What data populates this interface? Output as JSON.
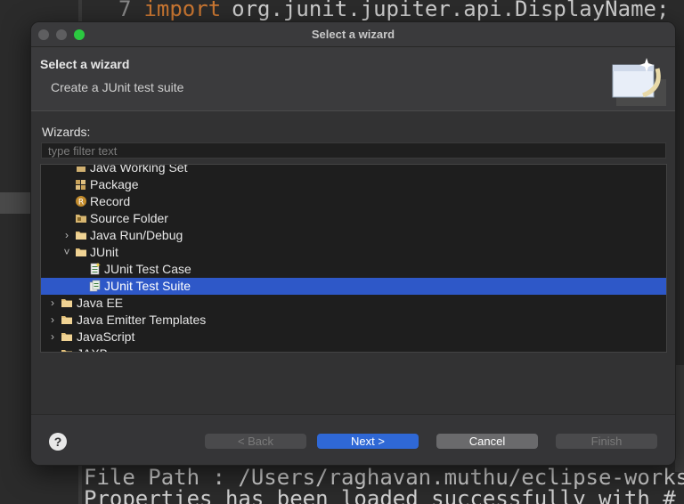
{
  "background": {
    "editor_line_number": "7",
    "editor_keyword": "import",
    "editor_code": "org.junit.jupiter.api.DisplayName;",
    "console_lines": [
      "File Path : /Users/raghavan.muthu/eclipse-works",
      "Properties has been loaded successfully with #"
    ]
  },
  "dialog": {
    "window_title": "Select a wizard",
    "header_title": "Select a wizard",
    "header_description": "Create a JUnit test suite",
    "wizards_label": "Wizards:",
    "filter_placeholder": "type filter text",
    "tree_items": [
      {
        "label": "Java Working Set",
        "level": 2,
        "icon": "working-set-icon",
        "chevron": ""
      },
      {
        "label": "Package",
        "level": 2,
        "icon": "package-icon",
        "chevron": ""
      },
      {
        "label": "Record",
        "level": 2,
        "icon": "record-icon",
        "chevron": ""
      },
      {
        "label": "Source Folder",
        "level": 2,
        "icon": "source-folder-icon",
        "chevron": ""
      },
      {
        "label": "Java Run/Debug",
        "level": 1,
        "icon": "folder-icon",
        "chevron": "collapsed"
      },
      {
        "label": "JUnit",
        "level": 1,
        "icon": "folder-icon",
        "chevron": "expanded"
      },
      {
        "label": "JUnit Test Case",
        "level": 3,
        "icon": "junit-test-case-icon",
        "chevron": ""
      },
      {
        "label": "JUnit Test Suite",
        "level": 3,
        "icon": "junit-test-suite-icon",
        "chevron": "",
        "selected": true
      },
      {
        "label": "Java EE",
        "level": 0,
        "icon": "folder-icon",
        "chevron": "collapsed"
      },
      {
        "label": "Java Emitter Templates",
        "level": 0,
        "icon": "folder-icon",
        "chevron": "collapsed"
      },
      {
        "label": "JavaScript",
        "level": 0,
        "icon": "folder-icon",
        "chevron": "collapsed"
      },
      {
        "label": "JAXB",
        "level": 0,
        "icon": "folder-icon",
        "chevron": "collapsed"
      }
    ],
    "buttons": {
      "help": "?",
      "back": "< Back",
      "next": "Next >",
      "cancel": "Cancel",
      "finish": "Finish"
    }
  },
  "colors": {
    "selection": "#2e58c8",
    "next_button": "#2f68d6",
    "keyword": "#cc7832"
  }
}
